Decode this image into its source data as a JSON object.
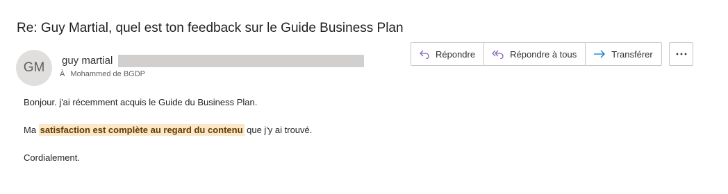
{
  "email": {
    "subject": "Re: Guy Martial, quel est ton feedback sur le Guide Business Plan",
    "sender": {
      "initials": "GM",
      "name": "guy martial"
    },
    "recipients": {
      "to_label": "À",
      "names": "Mohammed de BGDP"
    },
    "actions": {
      "reply": "Répondre",
      "reply_all": "Répondre à tous",
      "forward": "Transférer",
      "more_icon": "more-options-icon"
    },
    "body": {
      "line1": "Bonjour. j'ai récemment acquis le Guide du Business Plan.",
      "line2_prefix": "Ma ",
      "line2_highlight": "satisfaction est complète au regard du contenu",
      "line2_suffix": " que j'y ai trouvé.",
      "line3": "Cordialement."
    }
  },
  "colors": {
    "accent": "#0078d4",
    "highlight_bg": "#fde7c9",
    "avatar_bg": "#e1dfdd"
  }
}
